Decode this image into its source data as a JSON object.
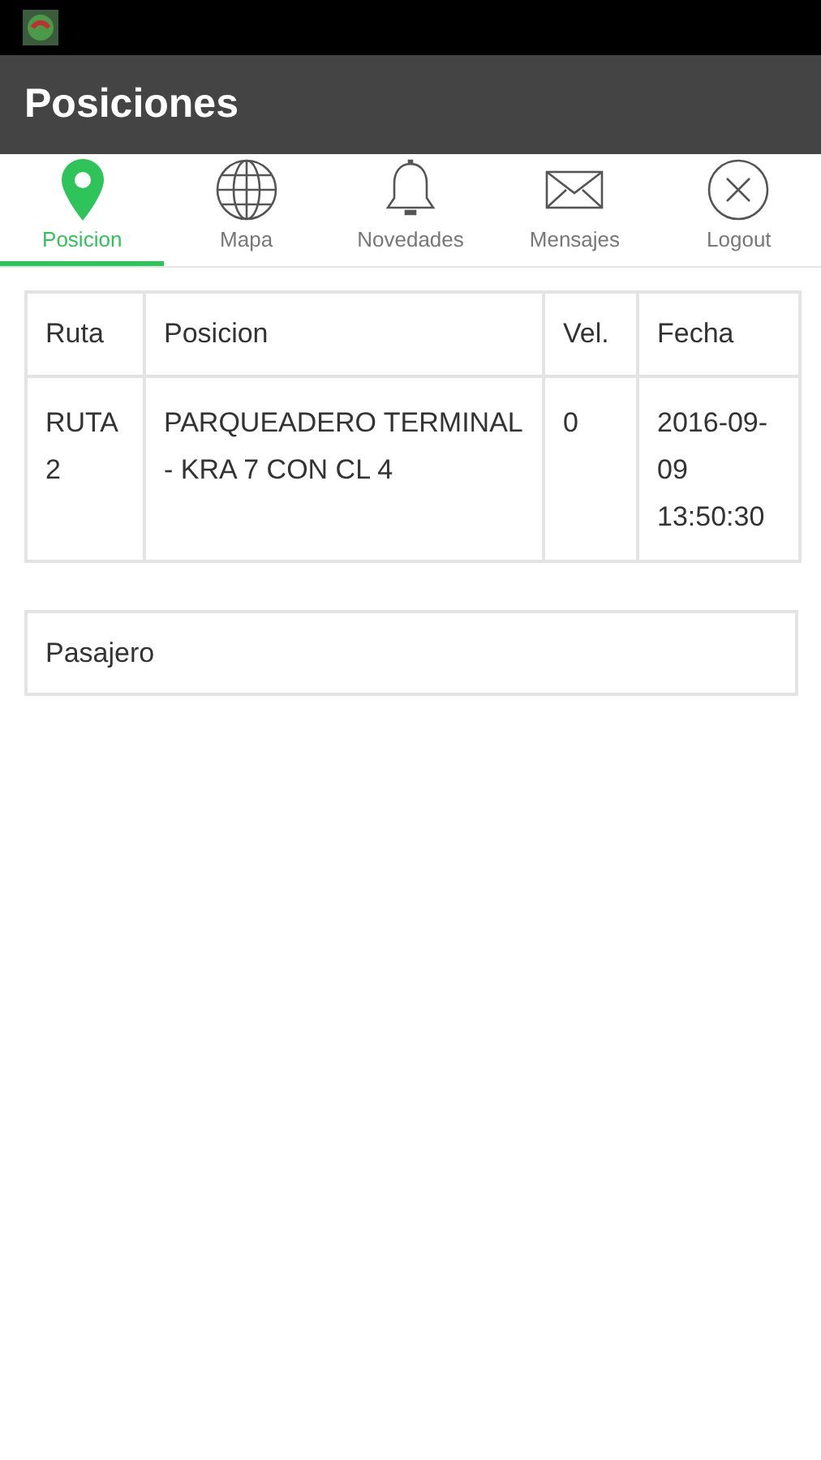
{
  "app_bar": {
    "title": "Posiciones"
  },
  "tabs": [
    {
      "label": "Posicion",
      "kind": "pin",
      "selected": true
    },
    {
      "label": "Mapa",
      "kind": "globe",
      "selected": false
    },
    {
      "label": "Novedades",
      "kind": "bell",
      "selected": false
    },
    {
      "label": "Mensajes",
      "kind": "mail",
      "selected": false
    },
    {
      "label": "Logout",
      "kind": "close",
      "selected": false
    }
  ],
  "table": {
    "columns": [
      "Ruta",
      "Posicion",
      "Vel.",
      "Fecha"
    ],
    "rows": [
      [
        "RUTA 2",
        "PARQUEADERO TERMINAL - KRA 7 CON CL 4",
        "0",
        "2016-09-09 13:50:30"
      ]
    ]
  },
  "passenger_panel": {
    "title": "Pasajero"
  }
}
